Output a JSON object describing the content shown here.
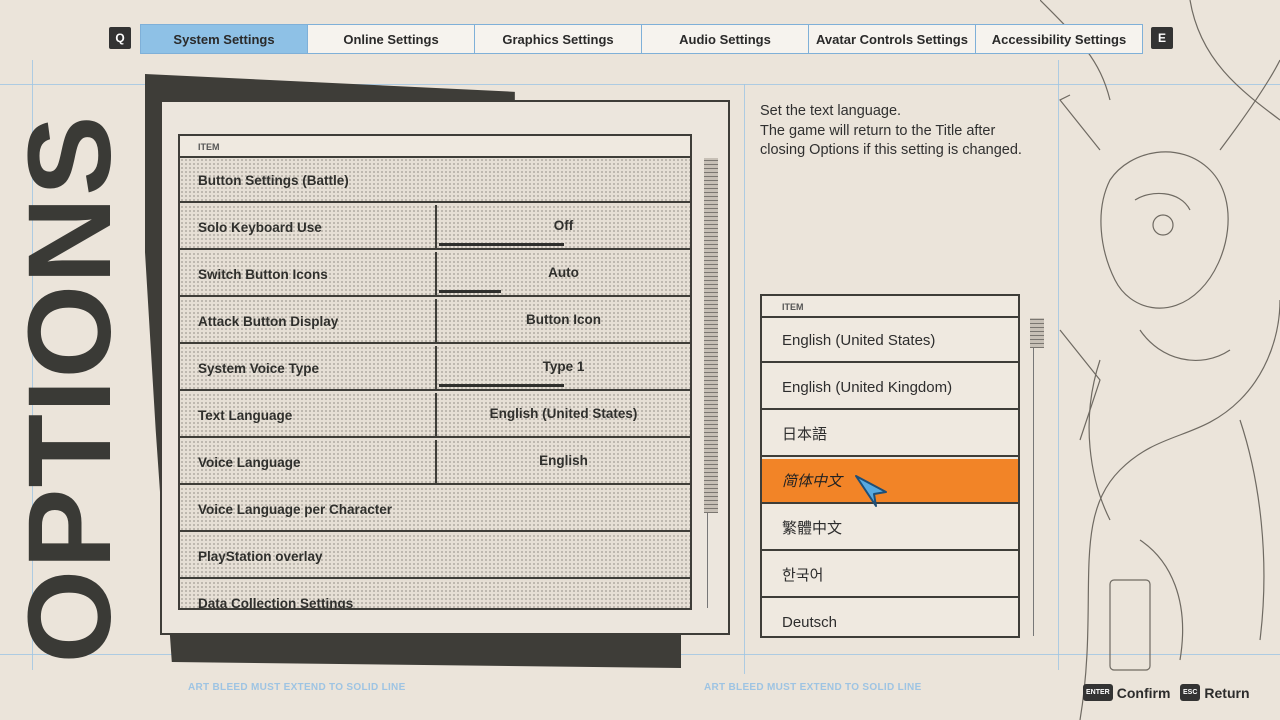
{
  "tabs": {
    "left_key": "Q",
    "right_key": "E",
    "items": [
      {
        "label": "System Settings",
        "active": true
      },
      {
        "label": "Online Settings",
        "active": false
      },
      {
        "label": "Graphics Settings",
        "active": false
      },
      {
        "label": "Audio Settings",
        "active": false
      },
      {
        "label": "Avatar Controls Settings",
        "active": false
      },
      {
        "label": "Accessibility Settings",
        "active": false
      }
    ]
  },
  "title": "OPTIONS",
  "settings": {
    "header": "ITEM",
    "rows": [
      {
        "label": "Button Settings (Battle)",
        "value": null
      },
      {
        "label": "Solo Keyboard Use",
        "value": "Off",
        "fill": 0.5
      },
      {
        "label": "Switch Button Icons",
        "value": "Auto",
        "fill": 0.25
      },
      {
        "label": "Attack Button Display",
        "value": "Button Icon",
        "fill": 0
      },
      {
        "label": "System Voice Type",
        "value": "Type 1",
        "fill": 0.5
      },
      {
        "label": "Text Language",
        "value": "English (United States)",
        "fill": 0
      },
      {
        "label": "Voice Language",
        "value": "English",
        "fill": 0
      },
      {
        "label": "Voice Language per Character",
        "value": null
      },
      {
        "label": "PlayStation overlay",
        "value": null
      },
      {
        "label": "Data Collection Settings",
        "value": null
      }
    ]
  },
  "description": {
    "line1": "Set the text language.",
    "line2": "The game will return to the Title after",
    "line3": "closing Options if this setting is changed."
  },
  "language_list": {
    "header": "ITEM",
    "items": [
      {
        "label": "English (United States)",
        "selected": false
      },
      {
        "label": "English (United Kingdom)",
        "selected": false
      },
      {
        "label": "日本語",
        "selected": false
      },
      {
        "label": "简体中文",
        "selected": true
      },
      {
        "label": "繁體中文",
        "selected": false
      },
      {
        "label": "한국어",
        "selected": false
      },
      {
        "label": "Deutsch",
        "selected": false
      }
    ]
  },
  "footer": {
    "bleed_left": "ART BLEED MUST EXTEND TO SOLID LINE",
    "bleed_right": "ART BLEED MUST EXTEND TO SOLID LINE",
    "confirm_key": "ENTER",
    "confirm_label": "Confirm",
    "return_key": "ESC",
    "return_label": "Return"
  },
  "colors": {
    "background": "#ebe4da",
    "tab_active": "#8ec1e6",
    "selection": "#f28427",
    "guide": "#9ec4e3",
    "ink": "#3e3d38"
  },
  "icons": [
    "pointer-cursor-icon",
    "character-sketch-art"
  ]
}
